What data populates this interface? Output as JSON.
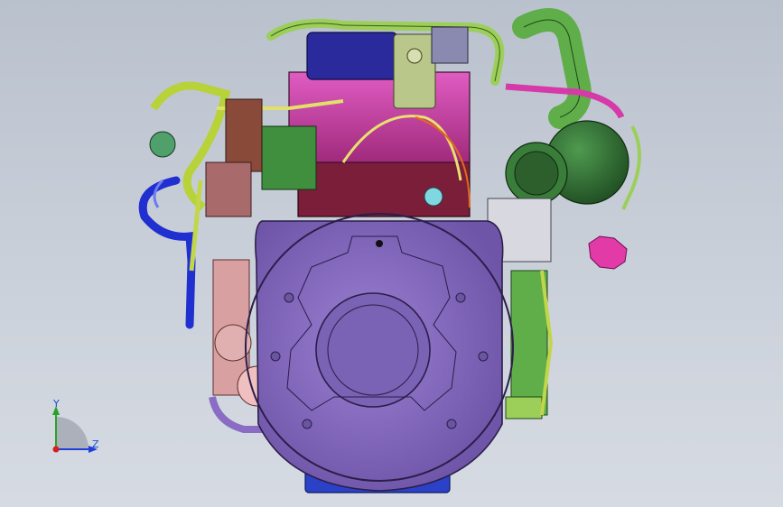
{
  "viewport": {
    "background_top": "#b9c1cd",
    "background_bottom": "#d6dbe3"
  },
  "model": {
    "flywheel_housing_color": "#8a6cc4",
    "cylinder_block_color": "#7a1e3a",
    "valve_cover_color": "#c8389c",
    "turbo_color": "#2f6b2f",
    "intake_pipe_color": "#9ccf5a",
    "oil_pan_color": "#2b42c8",
    "gasket_color": "#e23aa6",
    "dipstick_color": "#1f2fd0"
  },
  "triad": {
    "y_label": "Y",
    "z_label": "Z",
    "y_color": "#27a327",
    "z_color": "#1f3fd8",
    "origin_color": "#d61f1f"
  }
}
